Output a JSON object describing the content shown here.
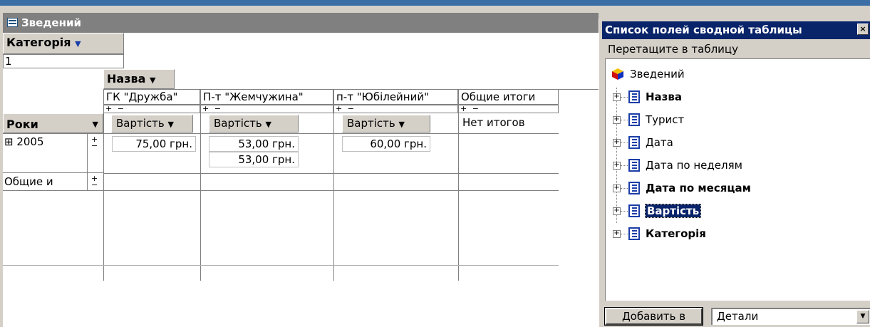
{
  "window": {
    "title": "Зведений"
  },
  "pivot": {
    "filter_field": "Категорія",
    "filter_value": "1",
    "column_field": "Назва",
    "column_headers": [
      "ГК \"Дружба\"",
      "П-т \"Жемчужина\"",
      "п-т \"Юбілейний\"",
      "Общие итоги"
    ],
    "expand_collapse": "+ −",
    "data_field": "Вартість",
    "no_totals": "Нет итогов",
    "row_field": "Роки",
    "row_item": "⊞ 2005",
    "row_values": [
      "75,00 грн.",
      "53,00 грн.",
      "60,00 грн."
    ],
    "row_values_extra": [
      "53,00 грн."
    ],
    "grand_total_label": "Общие и"
  },
  "field_list": {
    "title": "Список полей сводной таблицы",
    "close": "×",
    "instruction": "Перетащите в таблицу",
    "root": "Зведений",
    "items": [
      {
        "label": "Назва",
        "bold": true
      },
      {
        "label": "Турист",
        "bold": false
      },
      {
        "label": "Дата",
        "bold": false
      },
      {
        "label": "Дата по неделям",
        "bold": false
      },
      {
        "label": "Дата по месяцам",
        "bold": true
      },
      {
        "label": "Вартість",
        "bold": true,
        "selected": true
      },
      {
        "label": "Категорія",
        "bold": true
      }
    ],
    "add_button": "Добавить в",
    "area_value": "Детали"
  }
}
